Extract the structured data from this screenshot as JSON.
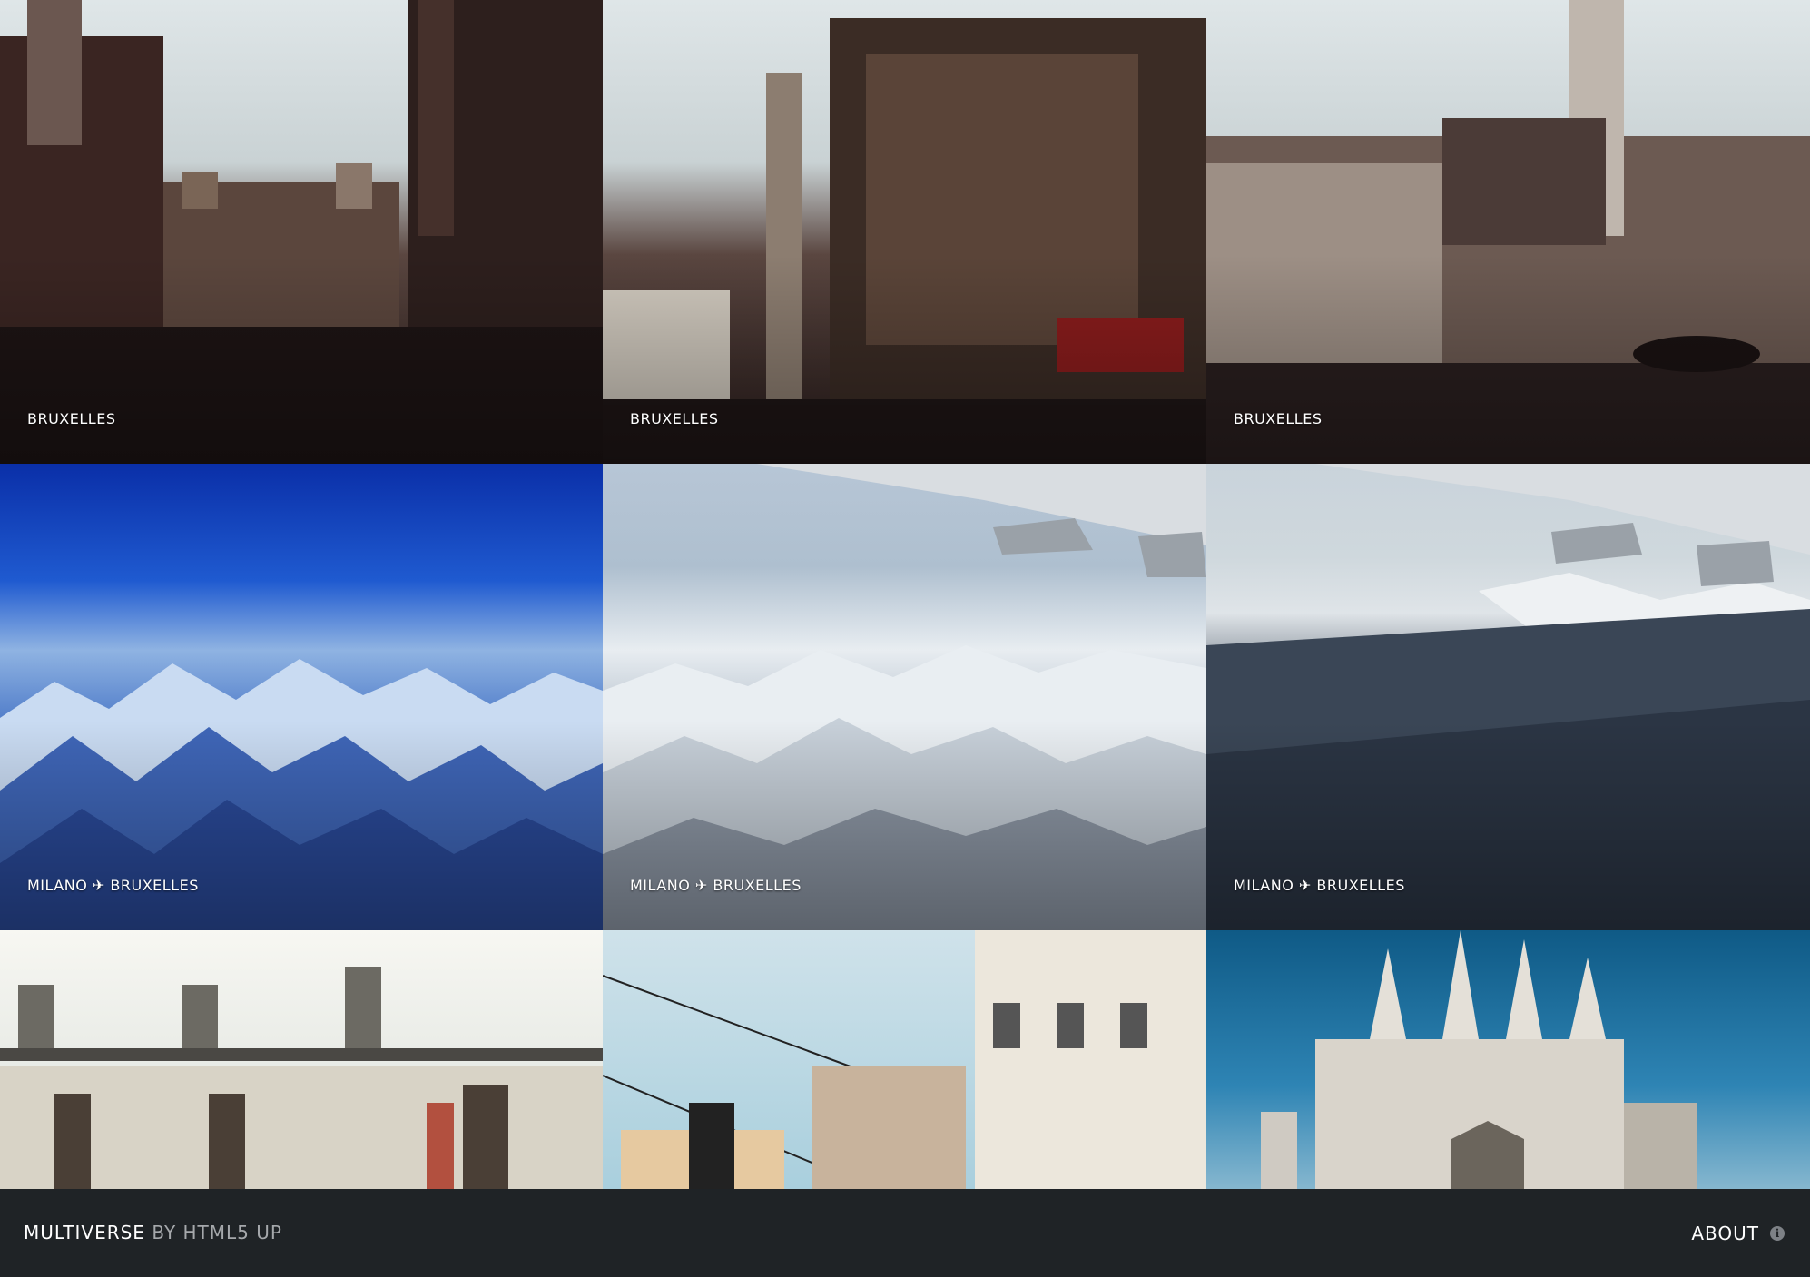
{
  "gallery": {
    "items": [
      {
        "caption": "BRUXELLES"
      },
      {
        "caption": "BRUXELLES"
      },
      {
        "caption": "BRUXELLES"
      },
      {
        "caption": "MILANO ✈ BRUXELLES"
      },
      {
        "caption": "MILANO ✈ BRUXELLES"
      },
      {
        "caption": "MILANO ✈ BRUXELLES"
      },
      {
        "caption": ""
      },
      {
        "caption": ""
      },
      {
        "caption": ""
      }
    ]
  },
  "footer": {
    "brand_name": "MULTIVERSE",
    "brand_by": "BY HTML5 UP",
    "about_label": "ABOUT",
    "info_glyph": "i"
  }
}
